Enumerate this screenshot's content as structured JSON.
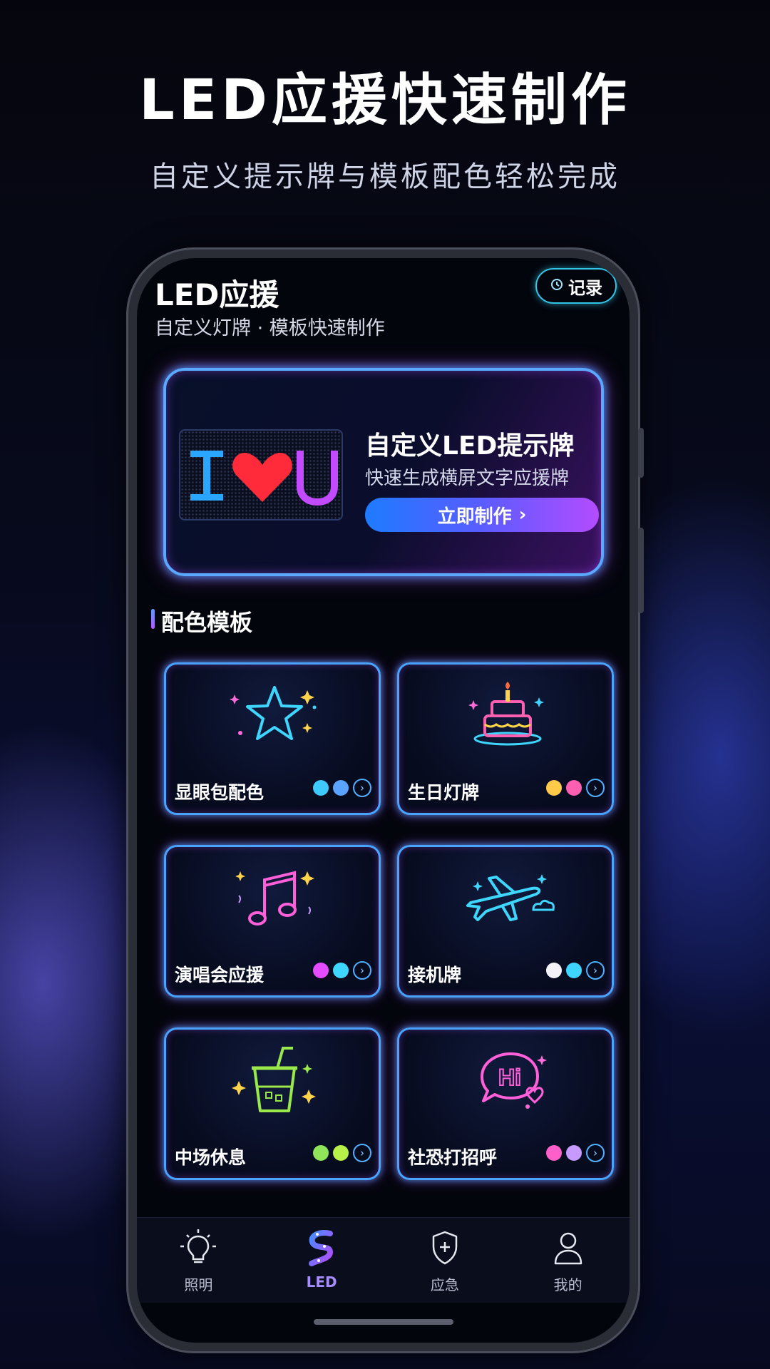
{
  "hero": {
    "title": "LED应援快速制作",
    "subtitle": "自定义提示牌与模板配色轻松完成"
  },
  "app": {
    "title": "LED应援",
    "subtitle": "自定义灯牌 · 模板快速制作",
    "record_label": "记录",
    "record_icon": "history-icon"
  },
  "banner": {
    "title": "自定义LED提示牌",
    "subtitle": "快速生成横屏文字应援牌",
    "cta_label": "立即制作",
    "cta_arrow": "›",
    "preview_text": "I ♥ U"
  },
  "section": {
    "title": "配色模板"
  },
  "templates": [
    {
      "label": "显眼包配色",
      "icon": "star-icon",
      "colors": [
        "#3ec9ff",
        "#5aa4ff"
      ]
    },
    {
      "label": "生日灯牌",
      "icon": "birthday-cake-icon",
      "colors": [
        "#ffc94a",
        "#ff5fb0"
      ]
    },
    {
      "label": "演唱会应援",
      "icon": "music-note-icon",
      "colors": [
        "#e64cff",
        "#3ed6ff"
      ]
    },
    {
      "label": "接机牌",
      "icon": "airplane-icon",
      "colors": [
        "#f4f4f8",
        "#3ed6ff"
      ]
    },
    {
      "label": "中场休息",
      "icon": "drink-cup-icon",
      "colors": [
        "#8fe45a",
        "#b8f04a"
      ]
    },
    {
      "label": "社恐打招呼",
      "icon": "hi-speech-bubble-icon",
      "colors": [
        "#ff5fc8",
        "#c69aff"
      ]
    }
  ],
  "go_arrow": "›",
  "tabs": [
    {
      "label": "照明",
      "icon": "light-bulb-icon",
      "active": false
    },
    {
      "label": "LED",
      "icon": "led-strip-icon",
      "active": true
    },
    {
      "label": "应急",
      "icon": "shield-plus-icon",
      "active": false
    },
    {
      "label": "我的",
      "icon": "user-icon",
      "active": false
    }
  ],
  "colors": {
    "accent_blue": "#4aa4ff",
    "accent_purple": "#b34cff",
    "active_tab": "#a58cff"
  }
}
